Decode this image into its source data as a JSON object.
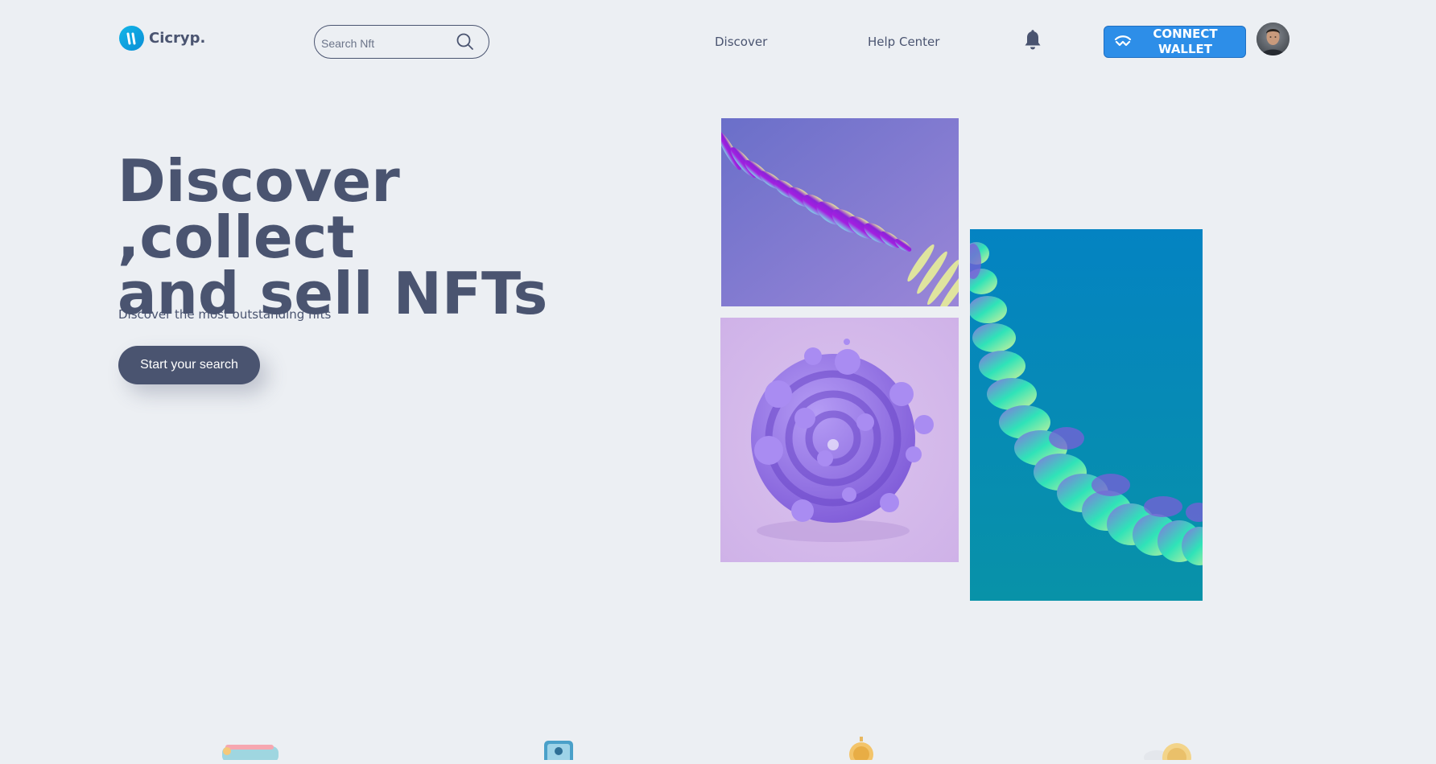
{
  "brand": {
    "name": "Cicryp."
  },
  "search": {
    "placeholder": "Search Nft"
  },
  "nav": {
    "discover": "Discover",
    "help_center": "Help Center"
  },
  "wallet": {
    "connect_line1": "CONNECT",
    "connect_line2": "WALLET"
  },
  "hero": {
    "title_line1": "Discover ,collect",
    "title_line2": "and sell NFTs",
    "subtitle": "Discover the most outstanding nfts",
    "cta": "Start your search"
  },
  "colors": {
    "background": "#eceff3",
    "text": "#4a5470",
    "accent_blue": "#2d8ee8",
    "logo": "#13b6e8"
  },
  "icons": [
    "logo-mark-icon",
    "search-icon",
    "bell-icon",
    "wallet-connect-icon",
    "avatar"
  ]
}
